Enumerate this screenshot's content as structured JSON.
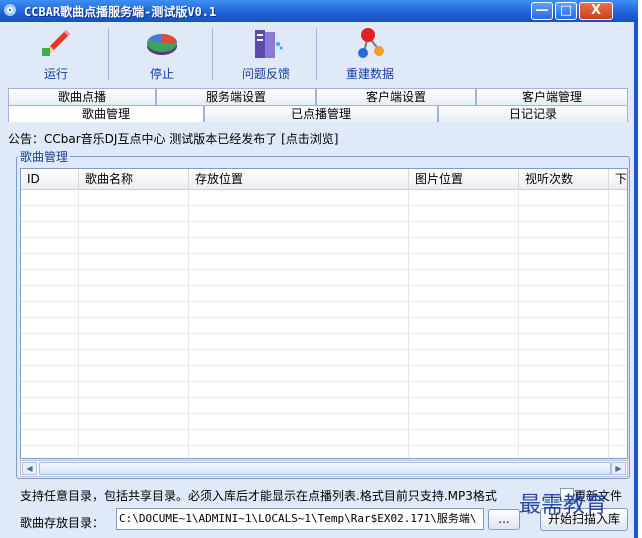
{
  "window": {
    "title": "CCBAR歌曲点播服务端-测试版V0.1",
    "controls": {
      "minimize": "—",
      "maximize": "□",
      "close": "X"
    }
  },
  "toolbar": {
    "items": [
      {
        "label": "运行",
        "icon": "pencil-run-icon"
      },
      {
        "label": "停止",
        "icon": "disc-stop-icon"
      },
      {
        "label": "问题反馈",
        "icon": "server-feedback-icon"
      },
      {
        "label": "重建数据",
        "icon": "molecule-rebuild-icon"
      }
    ]
  },
  "tabs": {
    "row1": [
      "歌曲点播",
      "服务端设置",
      "客户端设置",
      "客户端管理"
    ],
    "row2": [
      "歌曲管理",
      "已点播管理",
      "日记记录"
    ],
    "active": "歌曲管理"
  },
  "notice": "公告：CCbar音乐DJ互点中心 测试版本已经发布了 [点击浏览]",
  "group": {
    "label": "歌曲管理",
    "columns": [
      "ID",
      "歌曲名称",
      "存放位置",
      "图片位置",
      "视听次数",
      "下载"
    ],
    "rows": []
  },
  "hint": "支持任意目录，包括共享目录。必须入库后才能显示在点播列表.格式目前只支持.MP3格式",
  "checkbox_label": "更新文件",
  "path": {
    "label": "歌曲存放目录：",
    "value": "C:\\DOCUME~1\\ADMINI~1\\LOCALS~1\\Temp\\Rar$EX02.171\\服务端\\",
    "browse_label": "...",
    "scan_label": "开始扫描入库"
  },
  "watermark": "最需教育",
  "colors": {
    "titlebar": "#1f5fd6",
    "window_bg": "#dfe9f7",
    "label_blue": "#1540a0"
  }
}
